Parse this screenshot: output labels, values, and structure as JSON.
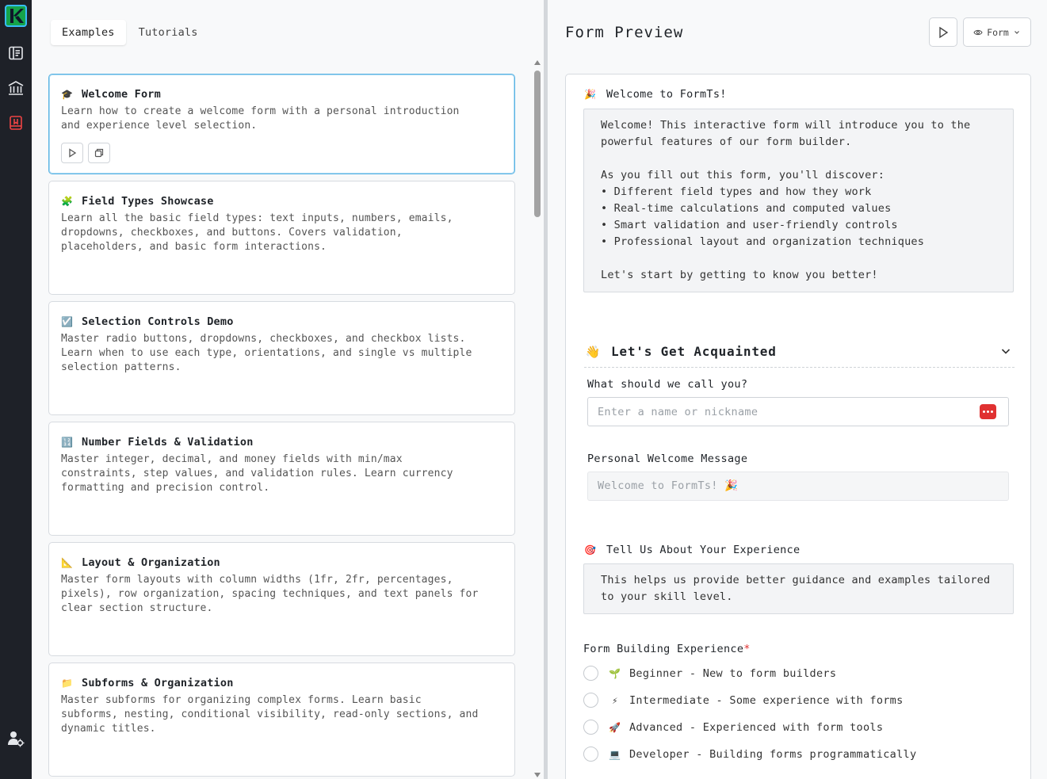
{
  "sidebar": {
    "items": [
      {
        "icon": "form-list-icon"
      },
      {
        "icon": "library-icon"
      },
      {
        "icon": "bookmark-icon"
      }
    ],
    "bottom_icon": "user-settings-icon"
  },
  "left": {
    "tabs": [
      {
        "label": "Examples",
        "active": true
      },
      {
        "label": "Tutorials",
        "active": false
      }
    ],
    "cards": [
      {
        "emoji": "🎓",
        "title": "Welcome Form",
        "desc": [
          "Learn how to create a welcome form with a personal introduction",
          "and experience level selection."
        ]
      },
      {
        "emoji": "🧩",
        "title": "Field Types Showcase",
        "desc": [
          "Learn all the basic field types: text inputs, numbers, emails,",
          "dropdowns, checkboxes, and buttons. Covers validation,",
          "placeholders, and basic form interactions."
        ]
      },
      {
        "emoji": "☑️",
        "title": "Selection Controls Demo",
        "desc": [
          "Master radio buttons, dropdowns, checkboxes, and checkbox lists.",
          "Learn when to use each type, orientations, and single vs multiple",
          "selection patterns."
        ]
      },
      {
        "emoji": "🔢",
        "title": "Number Fields & Validation",
        "desc": [
          "Master integer, decimal, and money fields with min/max",
          "constraints, step values, and validation rules. Learn currency",
          "formatting and precision control."
        ]
      },
      {
        "emoji": "📐",
        "title": "Layout & Organization",
        "desc": [
          "Master form layouts with column widths (1fr, 2fr, percentages,",
          "pixels), row organization, spacing techniques, and text panels for",
          "clear section structure."
        ]
      },
      {
        "emoji": "📁",
        "title": "Subforms & Organization",
        "desc": [
          "Master subforms for organizing complex forms. Learn basic",
          "subforms, nesting, conditional visibility, read-only sections, and",
          "dynamic titles."
        ]
      }
    ]
  },
  "right": {
    "title": "Form Preview",
    "mode_label": "Form",
    "form": {
      "welcome": {
        "emoji": "🎉",
        "title": "Welcome to FormTs!",
        "lines": [
          "Welcome! This interactive form will introduce you to the",
          "powerful features of our form builder.",
          "",
          "As you fill out this form, you'll discover:",
          "• Different field types and how they work",
          "• Real-time calculations and computed values",
          "• Smart validation and user-friendly controls",
          "• Professional layout and organization techniques",
          "",
          "Let's start by getting to know you better!"
        ]
      },
      "group": {
        "emoji": "👋",
        "title": "Let's Get Acquainted"
      },
      "name_label": "What should we call you?",
      "name_placeholder": "Enter a name or nickname",
      "message_label": "Personal Welcome Message",
      "message_value": "Welcome to FormTs! 🎉",
      "experience": {
        "emoji": "🎯",
        "title": "Tell Us About Your Experience",
        "lines": [
          "This helps us provide better guidance and examples tailored",
          "to your skill level."
        ]
      },
      "fb_label": "Form Building Experience",
      "required_mark": "*",
      "options": [
        {
          "emoji": "🌱",
          "label": "Beginner - New to form builders"
        },
        {
          "emoji": "⚡",
          "label": "Intermediate - Some experience with forms"
        },
        {
          "emoji": "🚀",
          "label": "Advanced - Experienced with form tools"
        },
        {
          "emoji": "💻",
          "label": "Developer - Building forms programmatically"
        }
      ]
    }
  },
  "colors": {
    "sidebar_bg": "#1e2128",
    "selected_border": "#5bb4e3",
    "required": "#e03131"
  }
}
